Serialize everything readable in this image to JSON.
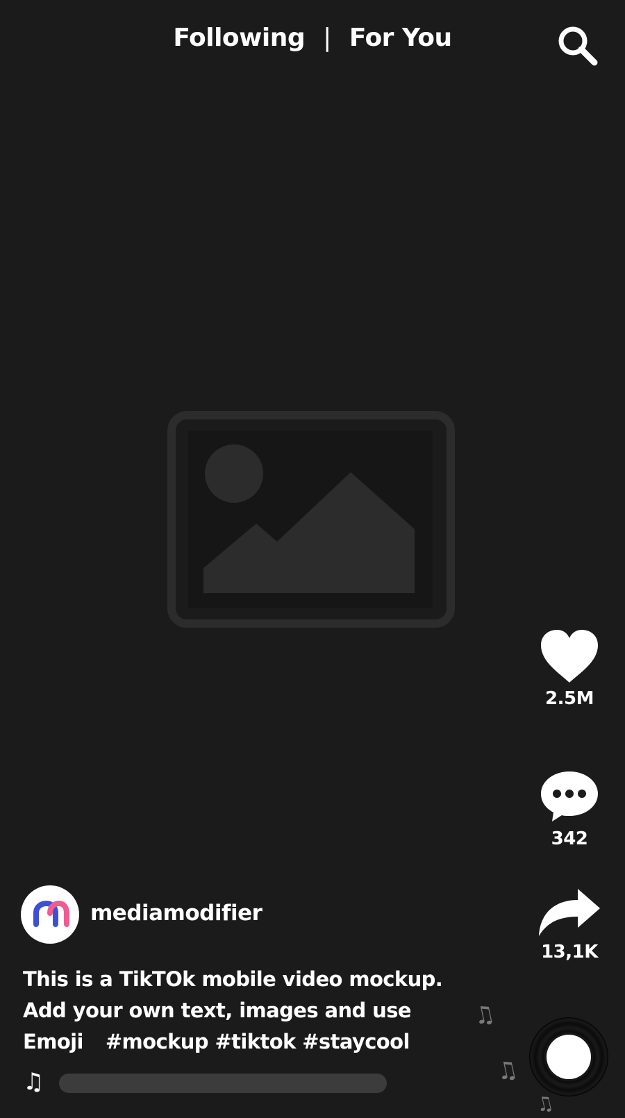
{
  "nav": {
    "following_label": "Following",
    "separator": "|",
    "for_you_label": "For You",
    "search_icon": "search-icon"
  },
  "video": {
    "placeholder_icon": "image-placeholder-icon"
  },
  "actions": {
    "like": {
      "icon": "heart-icon",
      "count": "2.5M"
    },
    "comment": {
      "icon": "comment-bubble-icon",
      "count": "342"
    },
    "share": {
      "icon": "share-arrow-icon",
      "count": "13,1K"
    }
  },
  "profile": {
    "username": "mediamodifier",
    "avatar_icon": "mediamodifier-logo-icon"
  },
  "caption": {
    "line1": "This is a TikTOk mobile video mockup.",
    "line2": "Add your own text, images and use",
    "line3_part1": "Emoji",
    "line3_part2": "#mockup #tiktok #staycool"
  },
  "music": {
    "note_symbol": "♫",
    "disc_icon": "music-disc-icon"
  },
  "colors": {
    "background": "#1b1b1b",
    "text": "#ffffff",
    "placeholder": "#2c2c2c",
    "music_track": "#3c3c3c",
    "avatar_blue": "#3d4fd6",
    "avatar_pink": "#f05b93"
  }
}
